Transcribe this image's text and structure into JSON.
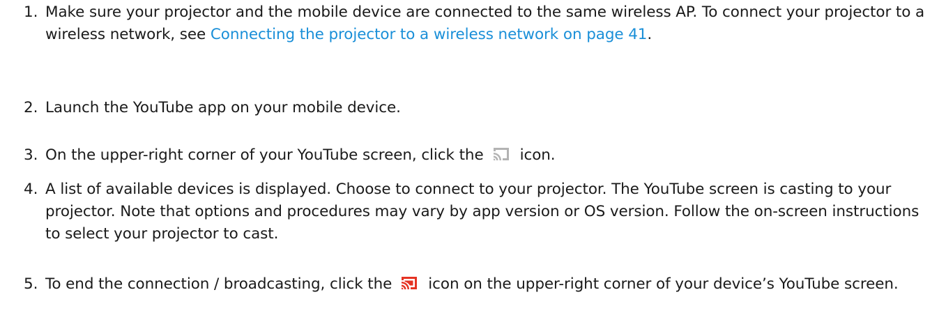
{
  "steps": [
    {
      "number": "1.",
      "text_before": "Make sure your projector and the mobile device are connected to the same wireless AP. To connect your projector to a wireless network, see ",
      "link": "Connecting the projector to a wireless network on page 41",
      "text_after": "."
    },
    {
      "number": "2.",
      "text": "Launch the YouTube app on your mobile device."
    },
    {
      "number": "3.",
      "text_before": "On the upper-right corner of your YouTube screen, click the",
      "icon": "cast-icon",
      "text_after": "icon."
    },
    {
      "number": "4.",
      "text": "A list of available devices is displayed. Choose to connect to your projector. The YouTube screen is casting to your projector. Note that options and procedures may vary by app version or OS version. Follow the on-screen instructions to select your projector to cast."
    },
    {
      "number": "5.",
      "text_before": "To end the connection / broadcasting, click the",
      "icon": "cast-connected-icon",
      "text_after": "icon on the upper-right corner of your device’s YouTube screen."
    }
  ],
  "colors": {
    "text": "#1a1a1a",
    "link": "#1a8fd8",
    "cast_icon_idle": "#b3b3b3",
    "cast_icon_active": "#e53323"
  }
}
